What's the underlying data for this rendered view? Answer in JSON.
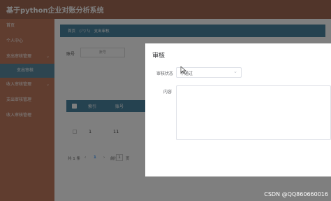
{
  "app": {
    "title": "基于python企业对账分析系统"
  },
  "sidebar": {
    "items": [
      {
        "label": "首页",
        "has_arrow": false
      },
      {
        "label": "个人中心",
        "has_arrow": false
      },
      {
        "label": "支出审核管理",
        "has_arrow": true
      },
      {
        "label": "支出审核",
        "has_arrow": false
      },
      {
        "label": "收入审核管理",
        "has_arrow": true
      },
      {
        "label": "支出审核管理",
        "has_arrow": false
      },
      {
        "label": "收入审核管理",
        "has_arrow": false
      }
    ],
    "active_index": 3,
    "arrow_glyph": "⌄"
  },
  "breadcrumb": {
    "home": "首页",
    "separator": "(╯▽╰)",
    "current": "支出审核"
  },
  "filter": {
    "label": "账号",
    "placeholder": "账号"
  },
  "table": {
    "headers": [
      "索引",
      "账号"
    ],
    "rows": [
      {
        "index": "1",
        "account": "11"
      }
    ]
  },
  "pagination": {
    "total": "共 1 条",
    "prev": "‹",
    "current": "1",
    "next": "›",
    "goto": "前往",
    "page_value": "1",
    "unit": "页"
  },
  "dialog": {
    "title": "审核",
    "status_label": "审核状态",
    "status_value": "不通过",
    "content_label": "内容"
  },
  "watermark": "CSDN @QQ860660016",
  "colors": {
    "topbar": "#a26a55",
    "sidebar": "#c17a5f",
    "accent": "#4b85a1",
    "active": "#5a8aa0"
  }
}
